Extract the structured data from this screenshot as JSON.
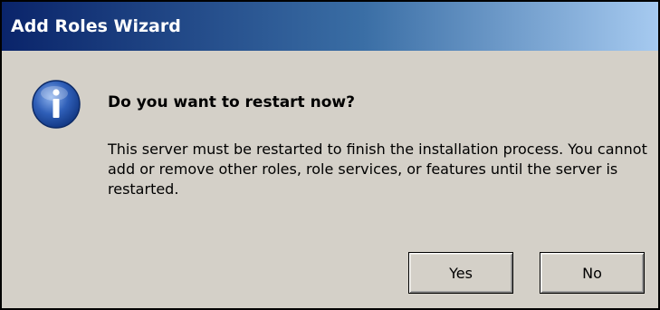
{
  "window": {
    "title": "Add Roles Wizard"
  },
  "dialog": {
    "icon": "info-icon",
    "heading": "Do you want to restart now?",
    "message": "This server must be restarted to finish the installation process. You cannot add or remove other roles, role services, or features until the server is restarted."
  },
  "buttons": {
    "yes_label": "Yes",
    "no_label": "No"
  },
  "colors": {
    "titlebar_start": "#0a246a",
    "titlebar_end": "#a6caf0",
    "dialog_background": "#d4d0c8",
    "icon_blue": "#2f5fb8"
  }
}
